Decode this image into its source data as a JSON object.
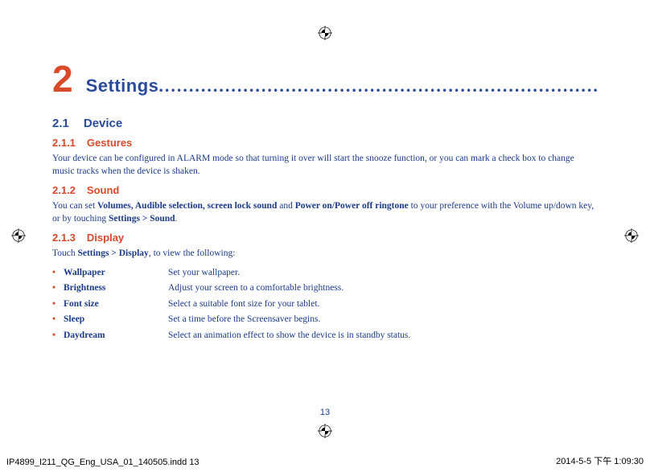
{
  "chapter": {
    "num": "2",
    "title": "Settings",
    "dots": "........................................................................."
  },
  "section_device": {
    "num": "2.1",
    "title": "Device"
  },
  "sec_gestures": {
    "num": "2.1.1",
    "title": "Gestures",
    "text": "Your device can be configured in ALARM mode so that turning it over will start the snooze function, or you can mark a check box to change music tracks when the device is shaken."
  },
  "sec_sound": {
    "num": "2.1.2",
    "title": "Sound",
    "text_pre": "You can set ",
    "bold1": "Volumes, Audible selection, screen lock sound",
    "mid1": " and ",
    "bold2": "Power on/Power off ringtone",
    "mid2": " to your preference with the Volume up/down key, or by touching ",
    "bold3": "Settings > Sound",
    "end": "."
  },
  "sec_display": {
    "num": "2.1.3",
    "title": "Display",
    "text_pre": "Touch ",
    "bold1": "Settings > Display",
    "text_post": ", to view the following:",
    "items": [
      {
        "term": "Wallpaper",
        "desc": "Set your wallpaper."
      },
      {
        "term": "Brightness",
        "desc": "Adjust your screen to a comfortable brightness."
      },
      {
        "term": "Font size",
        "desc": "Select a suitable font size for your tablet."
      },
      {
        "term": "Sleep",
        "desc": "Set a time before the Screensaver begins."
      },
      {
        "term": "Daydream",
        "desc": "Select an animation effect to show the device is in standby status."
      }
    ]
  },
  "page_num": "13",
  "footer": {
    "left": "IP4899_I211_QG_Eng_USA_01_140505.indd   13",
    "right": "2014-5-5   下午 1:09:30"
  }
}
